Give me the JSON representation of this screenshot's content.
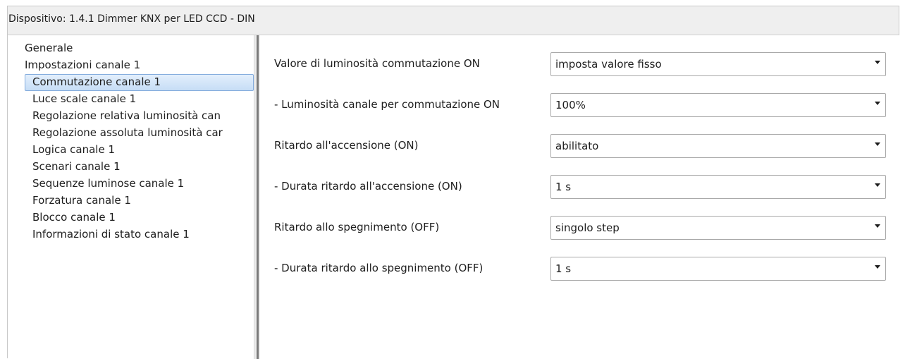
{
  "window": {
    "title": "Dispositivo: 1.4.1  Dimmer KNX per LED CCD - DIN"
  },
  "sidebar": {
    "items": [
      {
        "label": "Generale",
        "level": 0,
        "selected": false
      },
      {
        "label": "Impostazioni canale 1",
        "level": 0,
        "selected": false
      },
      {
        "label": "Commutazione canale 1",
        "level": 1,
        "selected": true
      },
      {
        "label": "Luce scale canale 1",
        "level": 1,
        "selected": false
      },
      {
        "label": "Regolazione relativa luminosità  can",
        "level": 1,
        "selected": false
      },
      {
        "label": "Regolazione assoluta luminosità  car",
        "level": 1,
        "selected": false
      },
      {
        "label": "Logica canale 1",
        "level": 1,
        "selected": false
      },
      {
        "label": "Scenari canale 1",
        "level": 1,
        "selected": false
      },
      {
        "label": "Sequenze luminose canale 1",
        "level": 1,
        "selected": false
      },
      {
        "label": "Forzatura canale 1",
        "level": 1,
        "selected": false
      },
      {
        "label": "Blocco canale 1",
        "level": 1,
        "selected": false
      },
      {
        "label": "Informazioni di stato canale 1",
        "level": 1,
        "selected": false
      }
    ]
  },
  "params": [
    {
      "label": "Valore di luminosità commutazione ON",
      "value": "imposta valore fisso"
    },
    {
      "label": "- Luminosità canale per commutazione ON",
      "value": "100%"
    },
    {
      "label": "Ritardo all'accensione (ON)",
      "value": "abilitato"
    },
    {
      "label": "- Durata ritardo all'accensione (ON)",
      "value": "1 s"
    },
    {
      "label": "Ritardo allo spegnimento (OFF)",
      "value": "singolo step"
    },
    {
      "label": "- Durata ritardo allo spegnimento (OFF)",
      "value": "1 s"
    }
  ],
  "colors": {
    "selection_background": "#c6ddf6",
    "selection_border": "#84acdd",
    "titlebar_background": "#efefef"
  }
}
